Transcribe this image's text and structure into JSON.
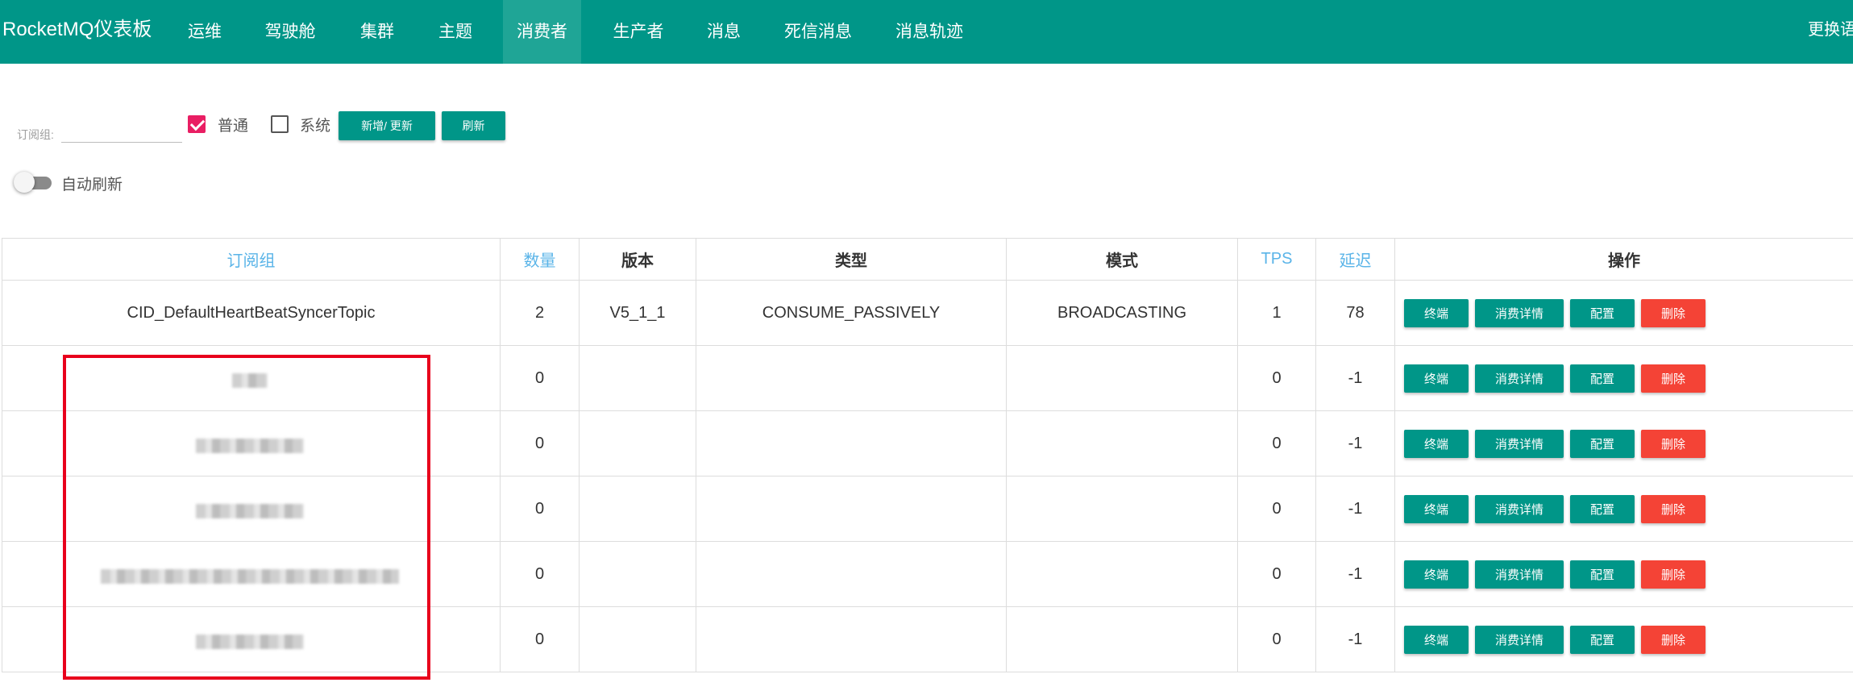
{
  "nav": {
    "brand": "RocketMQ仪表板",
    "items": [
      {
        "label": "运维"
      },
      {
        "label": "驾驶舱"
      },
      {
        "label": "集群"
      },
      {
        "label": "主题"
      },
      {
        "label": "消费者"
      },
      {
        "label": "生产者"
      },
      {
        "label": "消息"
      },
      {
        "label": "死信消息"
      },
      {
        "label": "消息轨迹"
      }
    ],
    "active_index": 4,
    "language_label": "更换语言"
  },
  "filter": {
    "label": "订阅组:",
    "value": "",
    "normal_label": "普通",
    "normal_checked": true,
    "system_label": "系统",
    "system_checked": false,
    "add_update_label": "新增/ 更新",
    "refresh_label": "刷新"
  },
  "auto_refresh": {
    "label": "自动刷新",
    "on": false
  },
  "table": {
    "headers": [
      "订阅组",
      "数量",
      "版本",
      "类型",
      "模式",
      "TPS",
      "延迟",
      "操作"
    ],
    "sortable_headers": [
      "订阅组",
      "数量",
      "TPS",
      "延迟"
    ],
    "action_labels": {
      "terminal": "终端",
      "detail": "消费详情",
      "config": "配置",
      "delete": "删除"
    },
    "rows": [
      {
        "group": "CID_DefaultHeartBeatSyncerTopic",
        "count": "2",
        "version": "V5_1_1",
        "type": "CONSUME_PASSIVELY",
        "mode": "BROADCASTING",
        "tps": "1",
        "delay": "78",
        "redacted": false
      },
      {
        "group": "",
        "count": "0",
        "version": "",
        "type": "",
        "mode": "",
        "tps": "0",
        "delay": "-1",
        "redacted": true
      },
      {
        "group": "",
        "count": "0",
        "version": "",
        "type": "",
        "mode": "",
        "tps": "0",
        "delay": "-1",
        "redacted": true
      },
      {
        "group": "",
        "count": "0",
        "version": "",
        "type": "",
        "mode": "",
        "tps": "0",
        "delay": "-1",
        "redacted": true
      },
      {
        "group": "",
        "count": "0",
        "version": "",
        "type": "",
        "mode": "",
        "tps": "0",
        "delay": "-1",
        "redacted": true
      },
      {
        "group": "",
        "count": "0",
        "version": "",
        "type": "",
        "mode": "",
        "tps": "0",
        "delay": "-1",
        "redacted": true
      }
    ]
  },
  "colors": {
    "primary": "#009688",
    "danger": "#f44336",
    "checkbox_checked": "#e91e63",
    "sortable_header": "#5ab4e8",
    "highlight_box": "#e8001c"
  }
}
